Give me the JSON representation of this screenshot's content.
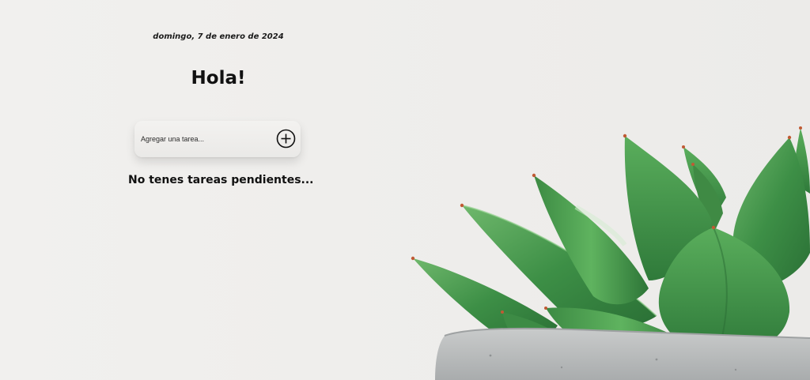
{
  "header": {
    "date": "domingo, 7 de enero de 2024",
    "greeting": "Hola!"
  },
  "task_form": {
    "placeholder": "Agregar una tarea...",
    "add_icon": "plus-circle-icon"
  },
  "tasks": {
    "empty_message": "No tenes tareas pendientes...",
    "items": []
  },
  "background": {
    "image": "succulent-plant-in-concrete-pot",
    "colors": {
      "wall": "#efeeec",
      "leaf": "#3f8f45",
      "leaf_light": "#7cc07a",
      "leaf_tip": "#c0552f",
      "pot": "#b9bcbd"
    }
  }
}
